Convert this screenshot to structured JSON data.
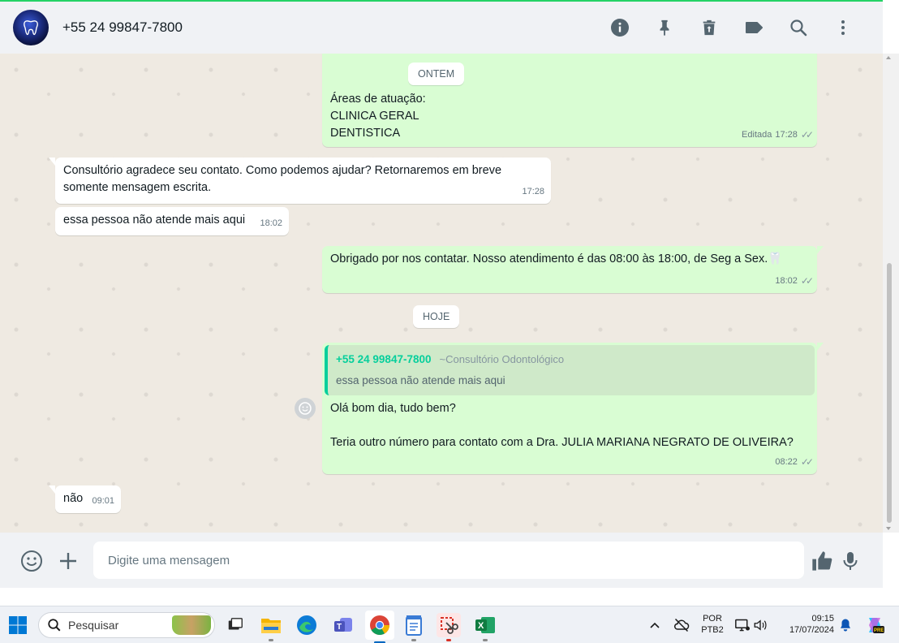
{
  "header": {
    "contact": "+55 24 99847-7800",
    "icons": [
      "info-icon",
      "pin-icon",
      "delete-icon",
      "label-icon",
      "search-icon",
      "menu-icon"
    ]
  },
  "messages": {
    "chip_yesterday": "ONTEM",
    "msg1": {
      "lines": [
        "Áreas de atuação:",
        "CLINICA GERAL",
        "DENTISTICA"
      ],
      "edited": "Editada",
      "time": "17:28"
    },
    "msg2": {
      "line1": "Consultório agradece seu contato. Como podemos ajudar? Retornaremos em breve",
      "line2": "somente mensagem escrita.",
      "time": "17:28"
    },
    "msg3": {
      "text": "essa pessoa não atende mais aqui",
      "time": "18:02"
    },
    "msg4": {
      "text": "Obrigado por nos contatar. Nosso atendimento é das 08:00 às 18:00, de Seg a Sex.",
      "emoji": "🦷",
      "time": "18:02"
    },
    "chip_today": "HOJE",
    "msg5": {
      "quote_sender": "+55 24 99847-7800",
      "quote_pushname": "~Consultório Odontológico",
      "quote_text": "essa pessoa não atende mais aqui",
      "line1": "Olá bom dia, tudo bem?",
      "line2": "Teria outro número para contato com a Dra. JULIA MARIANA NEGRATO DE OLIVEIRA?",
      "time": "08:22"
    },
    "msg6": {
      "text": "não",
      "time": "09:01"
    }
  },
  "composer": {
    "placeholder": "Digite uma mensagem"
  },
  "taskbar": {
    "search_label": "Pesquisar",
    "lang_line1": "POR",
    "lang_line2": "PTB2",
    "time": "09:15",
    "date": "17/07/2024",
    "copilot_badge": "PRE"
  },
  "colors": {
    "outgoing": "#d9fdd3",
    "incoming": "#ffffff",
    "accent": "#25d366",
    "quote_accent": "#06cf9c",
    "chat_bg": "#efeae2"
  }
}
